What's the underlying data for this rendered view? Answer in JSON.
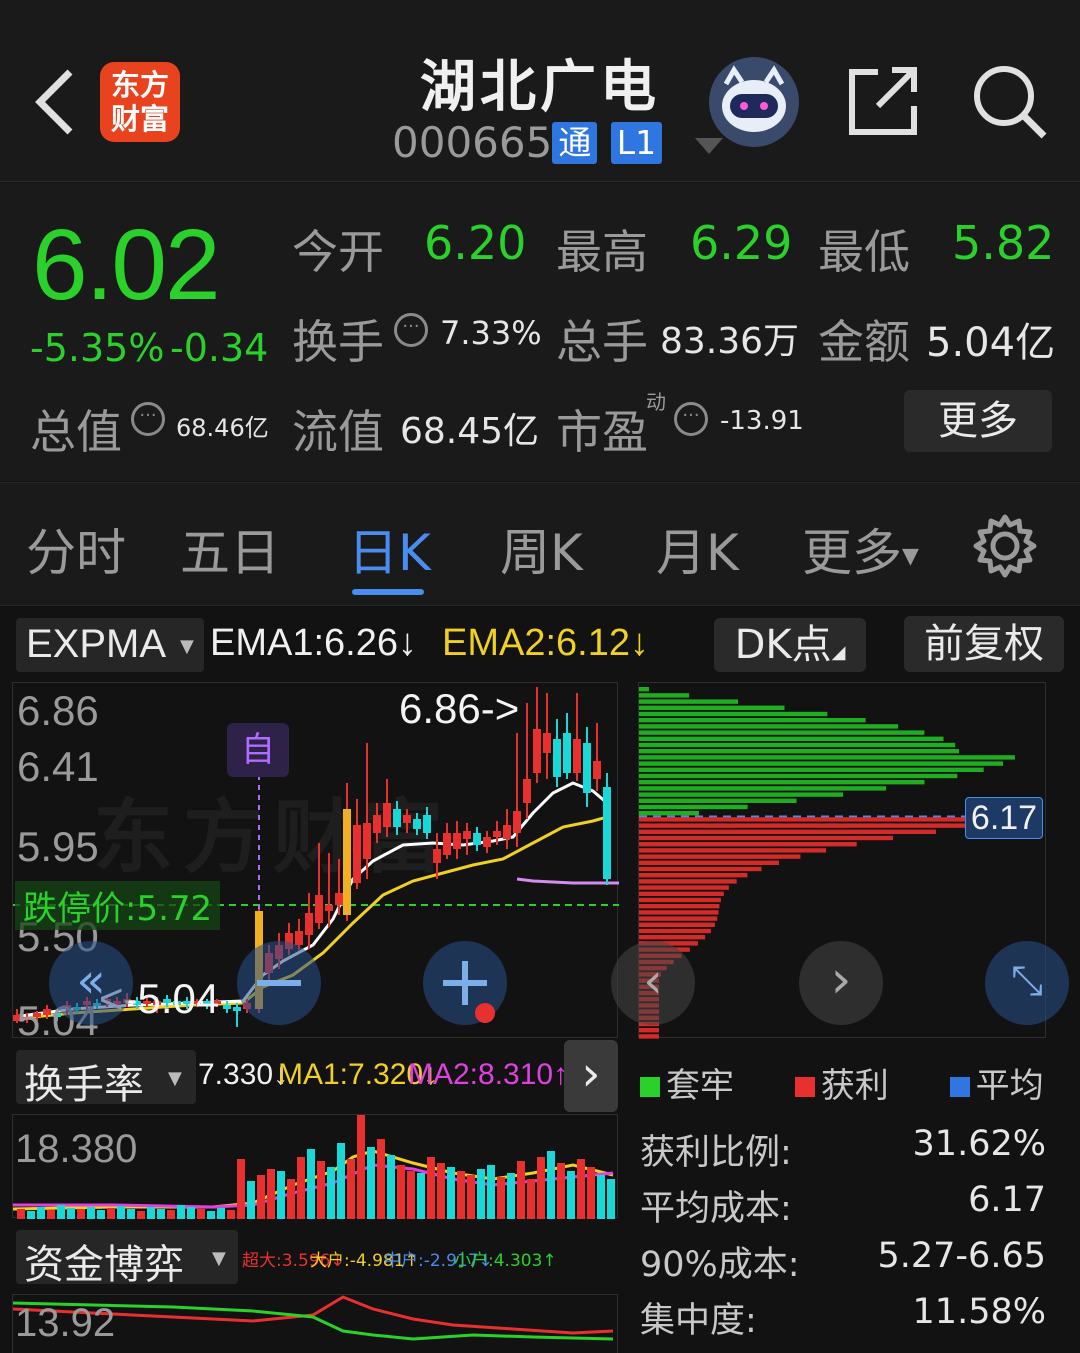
{
  "header": {
    "back_icon": "back-arrow-icon",
    "logo": "东方\n财富",
    "title": "湖北广电",
    "code": "000665",
    "tag1": "通",
    "tag2": "L1",
    "robot_icon": "robot-avatar-icon",
    "share_icon": "share-icon",
    "search_icon": "search-icon"
  },
  "quote": {
    "price": "6.02",
    "change_pct": "-5.35%",
    "change": "-0.34",
    "open_label": "今开",
    "open": "6.20",
    "high_label": "最高",
    "high": "6.29",
    "low_label": "最低",
    "low": "5.82",
    "turnover_label": "换手",
    "turnover": "7.33%",
    "volume_label": "总手",
    "volume": "83.36万",
    "amount_label": "金额",
    "amount": "5.04亿",
    "mcap_label": "总值",
    "mcap": "68.46亿",
    "float_label": "流值",
    "float": "68.45亿",
    "pe_label": "市盈",
    "pe_sup": "动",
    "pe": "-13.91",
    "more": "更多"
  },
  "tabs": [
    "分时",
    "五日",
    "日K",
    "周K",
    "月K",
    "更多"
  ],
  "tabs_active": 2,
  "kline": {
    "indicator": "EXPMA",
    "ema1": "EMA1:6.26↓",
    "ema2": "EMA2:6.12↓",
    "dk": "DK点",
    "adjust": "前复权",
    "y_labels": [
      "6.86",
      "6.41",
      "5.95",
      "5.50",
      "5.04"
    ],
    "max_label": "6.86->",
    "min_label": "<-5.04",
    "limit_down": "跌停价:5.72",
    "self_tag": "自",
    "cost_price": "6.17"
  },
  "turnover_panel": {
    "name": "换手率",
    "value": "7.330↓",
    "ma1": "MA1:7.320↓",
    "ma2": "MA2:8.310↑",
    "y": "18.380"
  },
  "fund_panel": {
    "name": "资金博弈",
    "super": "超大:3.596↓",
    "big": "大户:-4.981↑",
    "mid": "中户:-2.917↓",
    "small": "小户:4.303↑",
    "y": "13.92"
  },
  "chip": {
    "legend": [
      "套牢",
      "获利",
      "平均"
    ],
    "stats": [
      {
        "k": "获利比例:",
        "v": "31.62%"
      },
      {
        "k": "平均成本:",
        "v": "6.17"
      },
      {
        "k": "90%成本:",
        "v": "5.27-6.65"
      },
      {
        "k": "集中度:",
        "v": "11.58%"
      }
    ]
  },
  "colors": {
    "up": "#e8312f",
    "down": "#18d8d8",
    "green": "#2ad12a",
    "ema1": "#ffffff",
    "ema2": "#f0d020",
    "accent": "#4a8df0"
  }
}
